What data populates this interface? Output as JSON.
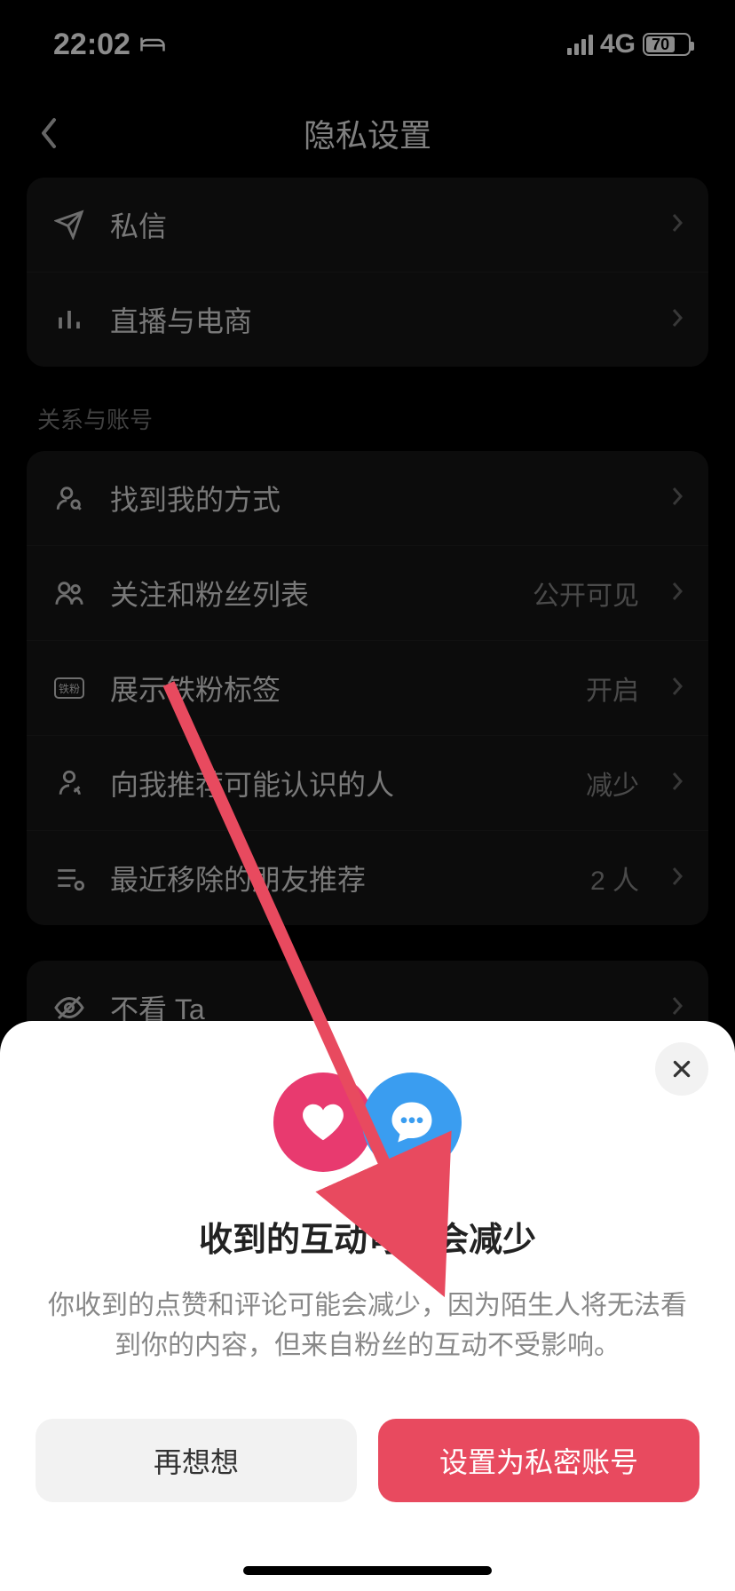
{
  "status": {
    "time": "22:02",
    "network": "4G",
    "battery": "70"
  },
  "header": {
    "title": "隐私设置"
  },
  "groups": {
    "g1": [
      {
        "icon": "send",
        "label": "私信",
        "value": ""
      },
      {
        "icon": "bars",
        "label": "直播与电商",
        "value": ""
      }
    ],
    "g2_title": "关系与账号",
    "g2": [
      {
        "icon": "personsearch",
        "label": "找到我的方式",
        "value": ""
      },
      {
        "icon": "group",
        "label": "关注和粉丝列表",
        "value": "公开可见"
      },
      {
        "icon": "badge",
        "label": "展示铁粉标签",
        "value": "开启"
      },
      {
        "icon": "friend",
        "label": "向我推荐可能认识的人",
        "value": "减少"
      },
      {
        "icon": "list",
        "label": "最近移除的朋友推荐",
        "value": "2 人"
      }
    ],
    "g3": [
      {
        "icon": "eyeoff",
        "label": "不看 Ta",
        "value": ""
      }
    ]
  },
  "sheet": {
    "title": "收到的互动可能会减少",
    "body": "你收到的点赞和评论可能会减少，因为陌生人将无法看到你的内容，但来自粉丝的互动不受影响。",
    "cancel": "再想想",
    "confirm": "设置为私密账号"
  },
  "annotation": {
    "arrowColor": "#e84a5f"
  }
}
